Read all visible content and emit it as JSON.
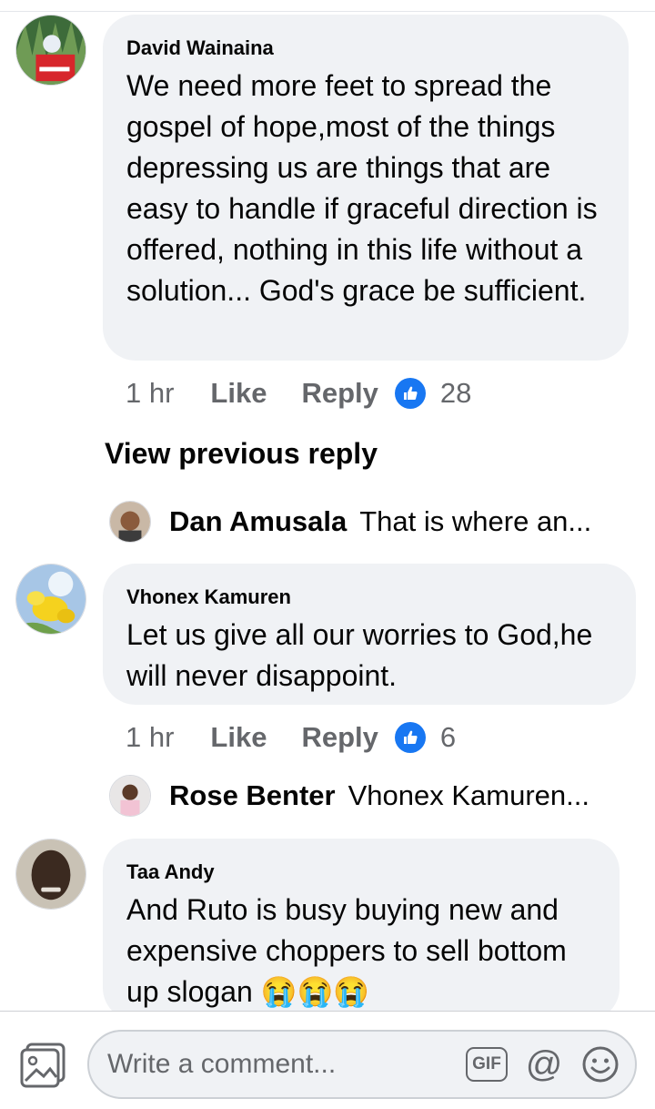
{
  "comments": [
    {
      "author": "David Wainaina",
      "text": "We need more feet to spread the gospel of hope,most of the things depressing us are things that are easy to handle if graceful direction is offered, nothing in this life without a solution... God's grace be sufficient.",
      "time": "1 hr",
      "like_label": "Like",
      "reply_label": "Reply",
      "like_count": "28"
    },
    {
      "author": "Vhonex Kamuren",
      "text": "Let us give all our worries to God,he will never disappoint.",
      "time": "1 hr",
      "like_label": "Like",
      "reply_label": "Reply",
      "like_count": "6"
    },
    {
      "author": "Taa Andy",
      "text": "And Ruto is busy buying new and expensive choppers to sell bottom up slogan 😭😭😭"
    }
  ],
  "view_previous_reply": "View previous reply",
  "replies": [
    {
      "name": "Dan Amusala",
      "text": "That is where an..."
    },
    {
      "name": "Rose Benter",
      "text": "Vhonex Kamuren..."
    }
  ],
  "composer": {
    "placeholder": "Write a comment...",
    "gif_label": "GIF",
    "at_label": "@",
    "photo_icon": "photo-icon",
    "emoji_icon": "emoji-icon"
  },
  "colors": {
    "bubble": "#f0f2f5",
    "like_badge": "#1877f2",
    "muted_text": "#65676b"
  }
}
